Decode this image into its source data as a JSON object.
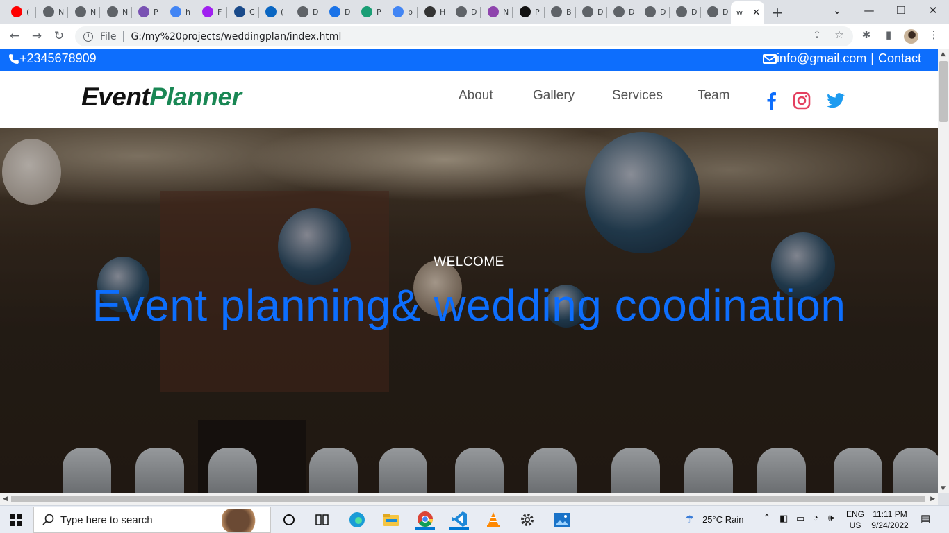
{
  "browser": {
    "tabs": [
      {
        "title": "(",
        "icon": "youtube-icon",
        "color": "#ff0000"
      },
      {
        "title": "N",
        "icon": "globe-icon",
        "color": "#5f6368"
      },
      {
        "title": "N",
        "icon": "globe-icon",
        "color": "#5f6368"
      },
      {
        "title": "N",
        "icon": "globe-icon",
        "color": "#5f6368"
      },
      {
        "title": "P",
        "icon": "bootstrap-icon",
        "color": "#7952b3"
      },
      {
        "title": "h",
        "icon": "google-icon",
        "color": "#4285f4"
      },
      {
        "title": "F",
        "icon": "firefox-icon",
        "color": "#a020f0"
      },
      {
        "title": "C",
        "icon": "circle-icon",
        "color": "#1a4a8a"
      },
      {
        "title": "(",
        "icon": "linkedin-icon",
        "color": "#0a66c2"
      },
      {
        "title": "D",
        "icon": "globe-icon",
        "color": "#5f6368"
      },
      {
        "title": "D",
        "icon": "download-icon",
        "color": "#1a73e8"
      },
      {
        "title": "P",
        "icon": "grammar-icon",
        "color": "#1a9e75"
      },
      {
        "title": "p",
        "icon": "google-icon",
        "color": "#4285f4"
      },
      {
        "title": "H",
        "icon": "github-icon",
        "color": "#333333"
      },
      {
        "title": "D",
        "icon": "globe-icon",
        "color": "#5f6368"
      },
      {
        "title": "N",
        "icon": "mail-icon",
        "color": "#8e44ad"
      },
      {
        "title": "P",
        "icon": "square-icon",
        "color": "#111111"
      },
      {
        "title": "B",
        "icon": "globe-icon",
        "color": "#5f6368"
      },
      {
        "title": "D",
        "icon": "globe-icon",
        "color": "#5f6368"
      },
      {
        "title": "D",
        "icon": "globe-icon",
        "color": "#5f6368"
      },
      {
        "title": "D",
        "icon": "globe-icon",
        "color": "#5f6368"
      },
      {
        "title": "D",
        "icon": "globe-icon",
        "color": "#5f6368"
      },
      {
        "title": "D",
        "icon": "globe-icon",
        "color": "#5f6368"
      }
    ],
    "active_tab": {
      "title": "w"
    },
    "file_label": "File",
    "url": "G:/my%20projects/weddingplan/index.html"
  },
  "topbar": {
    "phone": "+2345678909",
    "email": "info@gmail.com",
    "separator": "|",
    "contact": "Contact",
    "bg_color": "#0d6efd"
  },
  "header": {
    "logo_part1": "Event",
    "logo_part2": "Planner",
    "nav": [
      "About",
      "Gallery",
      "Services",
      "Team"
    ],
    "social": [
      "facebook-icon",
      "instagram-icon",
      "twitter-icon"
    ]
  },
  "hero": {
    "welcome": "WELCOME",
    "headline": "Event planning& wedding coodination",
    "headline_color": "#0d6efd"
  },
  "taskbar": {
    "search_placeholder": "Type here to search",
    "weather": "25°C  Rain",
    "lang": "ENG",
    "region": "US",
    "time": "11:11 PM",
    "date": "9/24/2022"
  }
}
